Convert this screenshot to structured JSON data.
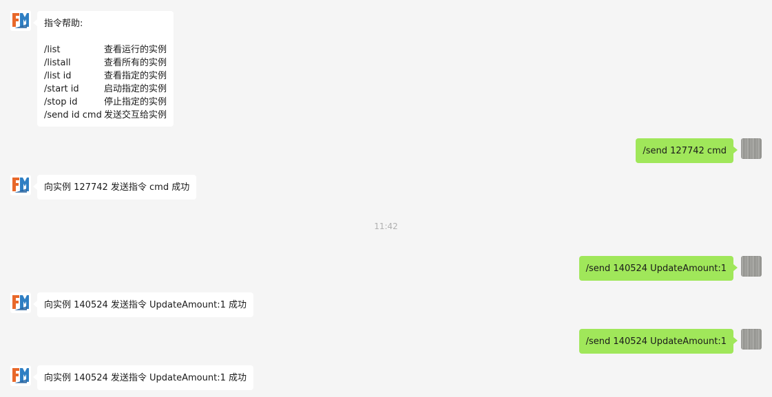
{
  "colors": {
    "background": "#f5f5f5",
    "bubble_in": "#ffffff",
    "bubble_out": "#a0e75a",
    "timestamp": "#b0b0b0"
  },
  "bot_avatar_icon": "fm-logo-icon",
  "user_avatar_icon": "gray-photo-avatar",
  "help": {
    "title": "指令帮助:",
    "commands": [
      {
        "cmd": "/list",
        "desc": "查看运行的实例"
      },
      {
        "cmd": "/listall",
        "desc": "查看所有的实例"
      },
      {
        "cmd": "/list id",
        "desc": "查看指定的实例"
      },
      {
        "cmd": "/start id",
        "desc": "启动指定的实例"
      },
      {
        "cmd": "/stop id",
        "desc": "停止指定的实例"
      },
      {
        "cmd": "/send id cmd",
        "desc": "发送交互给实例"
      }
    ]
  },
  "messages": [
    {
      "from": "user",
      "text": "/send 127742 cmd"
    },
    {
      "from": "bot",
      "text": "向实例 127742 发送指令 cmd 成功"
    },
    {
      "from": "time",
      "text": "11:42"
    },
    {
      "from": "user",
      "text": "/send 140524 UpdateAmount:1"
    },
    {
      "from": "bot",
      "text": "向实例 140524 发送指令 UpdateAmount:1 成功"
    },
    {
      "from": "user",
      "text": "/send 140524 UpdateAmount:1"
    },
    {
      "from": "bot",
      "text": "向实例 140524 发送指令 UpdateAmount:1 成功"
    }
  ]
}
